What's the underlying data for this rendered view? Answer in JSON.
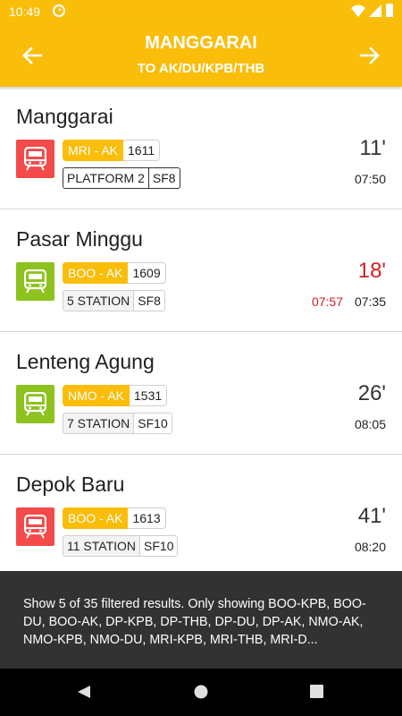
{
  "status_bar": {
    "time": "10:49",
    "icons": [
      "sync-icon",
      "wifi-icon",
      "signal-icon",
      "battery-icon"
    ]
  },
  "header": {
    "title": "MANGGARAI",
    "subtitle": "TO AK/DU/KPB/THB",
    "back_icon": "arrow-left-icon",
    "forward_icon": "arrow-right-icon"
  },
  "colors": {
    "accent": "#f9bd0a",
    "red": "#f44a4a",
    "green": "#8dc21f",
    "late": "#d32020",
    "snackbar": "#323232"
  },
  "departures": [
    {
      "station": "Manggarai",
      "icon_color": "red",
      "route": "MRI - AK",
      "train_no": "1611",
      "info_a": "PLATFORM 2",
      "info_b": "SF8",
      "minutes": "11'",
      "late": false,
      "estimated": "",
      "scheduled": "07:50"
    },
    {
      "station": "Pasar Minggu",
      "icon_color": "green",
      "route": "BOO - AK",
      "train_no": "1609",
      "info_a": "5 STATION",
      "info_b": "SF8",
      "minutes": "18'",
      "late": true,
      "estimated": "07:57",
      "scheduled": "07:35"
    },
    {
      "station": "Lenteng Agung",
      "icon_color": "green",
      "route": "NMO - AK",
      "train_no": "1531",
      "info_a": "7 STATION",
      "info_b": "SF10",
      "minutes": "26'",
      "late": false,
      "estimated": "",
      "scheduled": "08:05"
    },
    {
      "station": "Depok Baru",
      "icon_color": "red",
      "route": "BOO - AK",
      "train_no": "1613",
      "info_a": "11 STATION",
      "info_b": "SF10",
      "minutes": "41'",
      "late": false,
      "estimated": "",
      "scheduled": "08:20"
    }
  ],
  "snackbar": {
    "text": "Show 5 of 35 filtered results. Only showing BOO-KPB, BOO-DU, BOO-AK, DP-KPB, DP-THB, DP-DU, DP-AK, NMO-AK, NMO-KPB, NMO-DU, MRI-KPB, MRI-THB, MRI-D..."
  },
  "nav_bar": {
    "buttons": [
      "back-triangle-icon",
      "home-circle-icon",
      "recents-square-icon"
    ]
  }
}
